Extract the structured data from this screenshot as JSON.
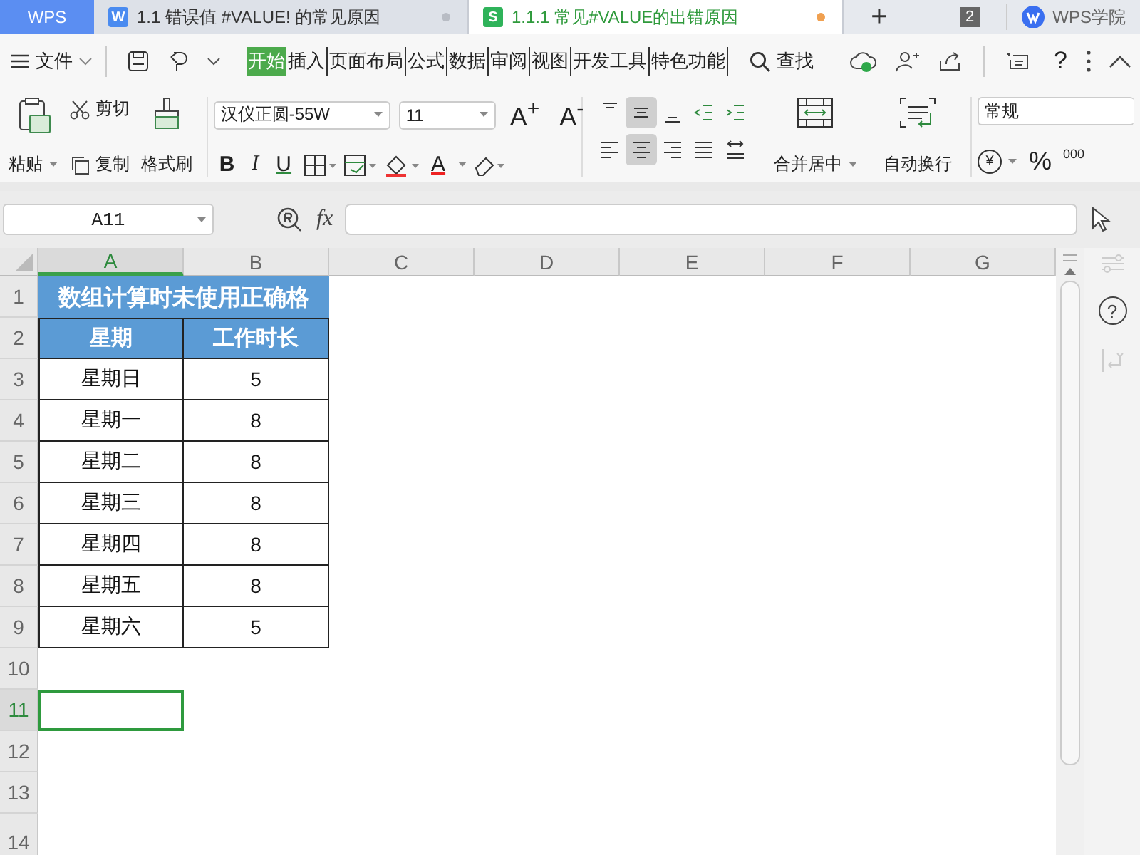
{
  "app_button": "WPS",
  "doc_tabs": [
    {
      "kind": "writer",
      "icon": "W",
      "title": "1.1 错误值 #VALUE! 的常见原因",
      "selected": false,
      "modified": false
    },
    {
      "kind": "sheet",
      "icon": "S",
      "title": "1.1.1 常见#VALUE的出错原因",
      "selected": true,
      "modified": true
    }
  ],
  "new_tab": "+",
  "window_count": "2",
  "academy": "WPS学院",
  "menu": {
    "file": "文件",
    "tabs": [
      {
        "label": "开始",
        "selected": true
      },
      {
        "label": "插入",
        "selected": false
      },
      {
        "label": "页面布局",
        "selected": false
      },
      {
        "label": "公式",
        "selected": false
      },
      {
        "label": "数据",
        "selected": false
      },
      {
        "label": "审阅",
        "selected": false
      },
      {
        "label": "视图",
        "selected": false
      },
      {
        "label": "开发工具",
        "selected": false
      },
      {
        "label": "特色功能",
        "selected": false
      }
    ],
    "search": "查找",
    "help": "?"
  },
  "ribbon": {
    "paste": "粘贴",
    "cut": "剪切",
    "copy": "复制",
    "format_painter": "格式刷",
    "font_name": "汉仪正圆-55W",
    "font_size": "11",
    "grow_font": "A$^{+}$",
    "shrink_font": "A$^{-}$",
    "font_color": "A",
    "bold": "B",
    "italic": "I",
    "underline": "U",
    "alignment": [
      {
        "kind": "top",
        "selected": false
      },
      {
        "kind": "middle",
        "selected": true
      },
      {
        "kind": "bottom",
        "selected": false
      },
      {
        "kind": "outdent",
        "selected": false
      },
      {
        "kind": "indent",
        "selected": false
      },
      {
        "kind": "left",
        "selected": false
      },
      {
        "kind": "center",
        "selected": true
      },
      {
        "kind": "right",
        "selected": false
      },
      {
        "kind": "justify",
        "selected": false
      },
      {
        "kind": "distribute",
        "selected": false
      }
    ],
    "merge": "合并居中",
    "wrap": "自动换行",
    "number_format": "常规",
    "currency": "¥",
    "percent": "%",
    "thousands": "000"
  },
  "formula_bar": {
    "name_box": "A11",
    "fx": "fx"
  },
  "side_help": "?",
  "sheet": {
    "columns": [
      {
        "label": "A",
        "selected": true
      },
      {
        "label": "B",
        "selected": false
      },
      {
        "label": "C",
        "selected": false
      },
      {
        "label": "D",
        "selected": false
      },
      {
        "label": "E",
        "selected": false
      },
      {
        "label": "F",
        "selected": false
      },
      {
        "label": "G",
        "selected": false
      }
    ],
    "rows": [
      {
        "label": "1",
        "selected": false
      },
      {
        "label": "2",
        "selected": false
      },
      {
        "label": "3",
        "selected": false
      },
      {
        "label": "4",
        "selected": false
      },
      {
        "label": "5",
        "selected": false
      },
      {
        "label": "6",
        "selected": false
      },
      {
        "label": "7",
        "selected": false
      },
      {
        "label": "8",
        "selected": false
      },
      {
        "label": "9",
        "selected": false
      },
      {
        "label": "10",
        "selected": false
      },
      {
        "label": "11",
        "selected": true
      },
      {
        "label": "12",
        "selected": false
      },
      {
        "label": "13",
        "selected": false
      },
      {
        "label": "14",
        "selected": false
      }
    ],
    "title": "数组计算时未使用正确格",
    "header": [
      "星期",
      "工作时长"
    ],
    "data": [
      [
        "星期日",
        "5"
      ],
      [
        "星期一",
        "8"
      ],
      [
        "星期二",
        "8"
      ],
      [
        "星期三",
        "8"
      ],
      [
        "星期四",
        "8"
      ],
      [
        "星期五",
        "8"
      ],
      [
        "星期六",
        "5"
      ]
    ]
  }
}
